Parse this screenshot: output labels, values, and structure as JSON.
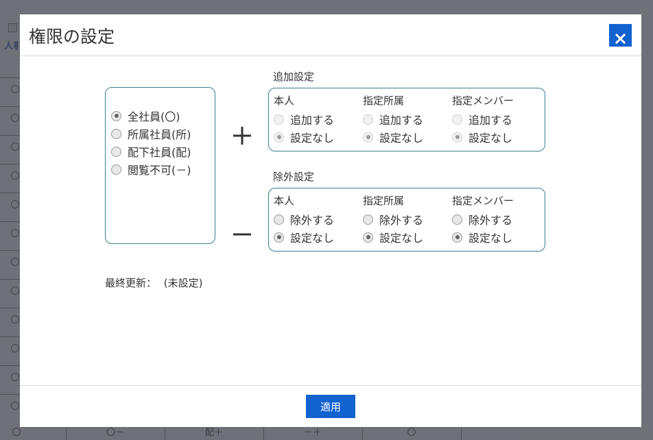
{
  "background": {
    "peek_text": "人事",
    "bottom_row": [
      "〇",
      "〇－",
      "配＋",
      "－＋",
      "〇"
    ]
  },
  "modal": {
    "title": "権限の設定",
    "close_icon": "close-icon",
    "base_options": [
      {
        "label": "全社員(〇)",
        "checked": true
      },
      {
        "label": "所属社員(所)",
        "checked": false
      },
      {
        "label": "配下社員(配)",
        "checked": false
      },
      {
        "label": "閲覧不可(－)",
        "checked": false
      }
    ],
    "add_section": {
      "title": "追加設定",
      "sign": "plus-sign",
      "columns": [
        {
          "title": "本人",
          "option1": "追加する",
          "option2": "設定なし"
        },
        {
          "title": "指定所属",
          "option1": "追加する",
          "option2": "設定なし"
        },
        {
          "title": "指定メンバー",
          "option1": "追加する",
          "option2": "設定なし"
        }
      ]
    },
    "exclude_section": {
      "title": "除外設定",
      "sign": "minus-sign",
      "columns": [
        {
          "title": "本人",
          "option1": "除外する",
          "option2": "設定なし"
        },
        {
          "title": "指定所属",
          "option1": "除外する",
          "option2": "設定なし"
        },
        {
          "title": "指定メンバー",
          "option1": "除外する",
          "option2": "設定なし"
        }
      ]
    },
    "last_update": {
      "label": "最終更新：",
      "value": "(未設定)"
    },
    "apply_label": "適用",
    "accent_color": "#1262cf",
    "border_color": "#3a7d8c"
  }
}
